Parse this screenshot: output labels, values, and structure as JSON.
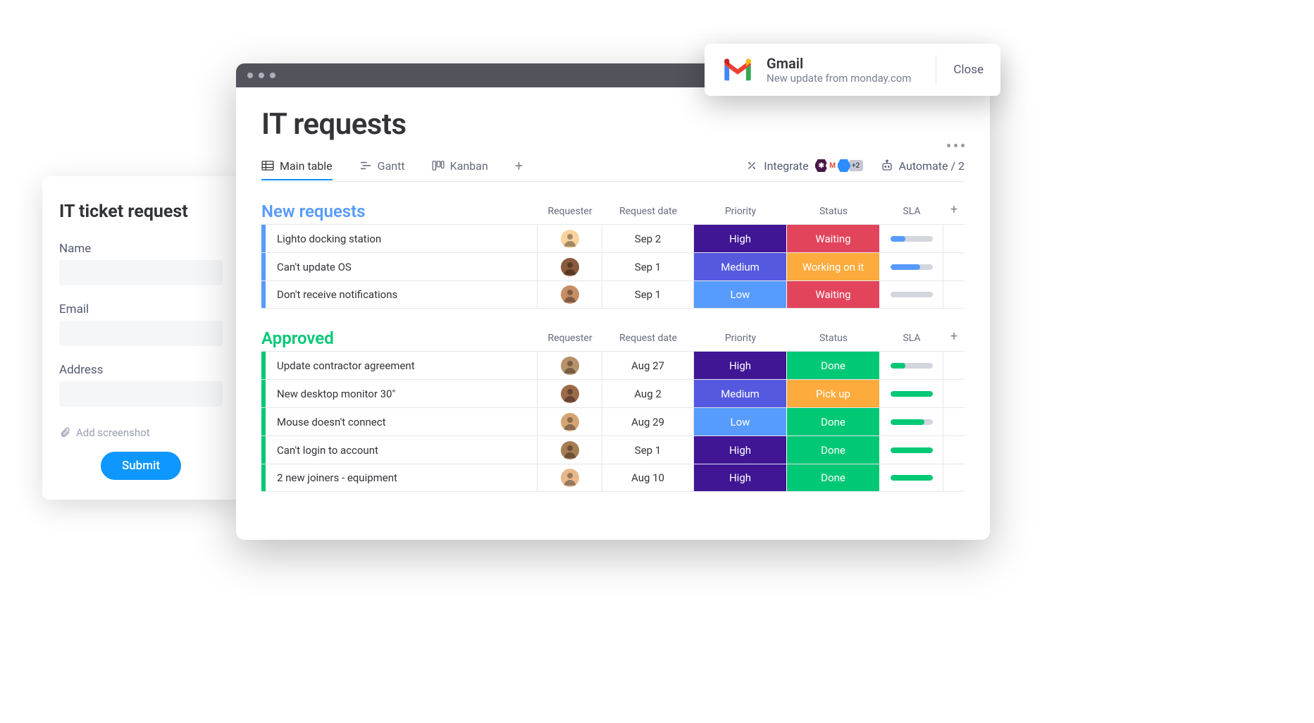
{
  "form": {
    "title": "IT ticket request",
    "fields": {
      "name": "Name",
      "email": "Email",
      "address": "Address"
    },
    "add_screenshot": "Add screenshot",
    "submit": "Submit"
  },
  "board": {
    "title": "IT requests",
    "tabs": [
      {
        "label": "Main table"
      },
      {
        "label": "Gantt"
      },
      {
        "label": "Kanban"
      }
    ],
    "integrate_label": "Integrate",
    "integrate_more": "+2",
    "automate_label": "Automate / 2",
    "columns": {
      "requester": "Requester",
      "date": "Request date",
      "priority": "Priority",
      "status": "Status",
      "sla": "SLA"
    },
    "groups": [
      {
        "title": "New requests",
        "color": "blue",
        "rows": [
          {
            "name": "Lighto docking station",
            "avatar_bg": "#f9d29d",
            "date": "Sep 2",
            "priority": "High",
            "priority_color": "#401694",
            "status": "Waiting",
            "status_color": "#e2445c",
            "sla_pct": 35,
            "sla_color": "#579bfc"
          },
          {
            "name": "Can't update OS",
            "avatar_bg": "#8b5a3c",
            "date": "Sep 1",
            "priority": "Medium",
            "priority_color": "#5559df",
            "status": "Working on it",
            "status_color": "#fdab3d",
            "sla_pct": 70,
            "sla_color": "#579bfc"
          },
          {
            "name": "Don't receive notifications",
            "avatar_bg": "#c78d64",
            "date": "Sep 1",
            "priority": "Low",
            "priority_color": "#579bfc",
            "status": "Waiting",
            "status_color": "#e2445c",
            "sla_pct": 0,
            "sla_color": "#d4d6de"
          }
        ]
      },
      {
        "title": "Approved",
        "color": "green",
        "rows": [
          {
            "name": "Update contractor agreement",
            "avatar_bg": "#b8906a",
            "date": "Aug 27",
            "priority": "High",
            "priority_color": "#401694",
            "status": "Done",
            "status_color": "#00c875",
            "sla_pct": 35,
            "sla_color": "#00c875"
          },
          {
            "name": "New desktop monitor 30\"",
            "avatar_bg": "#9b6b4a",
            "date": "Aug 2",
            "priority": "Medium",
            "priority_color": "#5559df",
            "status": "Pick up",
            "status_color": "#fdab3d",
            "sla_pct": 100,
            "sla_color": "#00c875"
          },
          {
            "name": "Mouse doesn't connect",
            "avatar_bg": "#d4a574",
            "date": "Aug 29",
            "priority": "Low",
            "priority_color": "#579bfc",
            "status": "Done",
            "status_color": "#00c875",
            "sla_pct": 80,
            "sla_color": "#00c875"
          },
          {
            "name": "Can't login to account",
            "avatar_bg": "#a67c52",
            "date": "Sep 1",
            "priority": "High",
            "priority_color": "#401694",
            "status": "Done",
            "status_color": "#00c875",
            "sla_pct": 100,
            "sla_color": "#00c875"
          },
          {
            "name": "2 new joiners - equipment",
            "avatar_bg": "#e8b88a",
            "date": "Aug 10",
            "priority": "High",
            "priority_color": "#401694",
            "status": "Done",
            "status_color": "#00c875",
            "sla_pct": 100,
            "sla_color": "#00c875"
          }
        ]
      }
    ]
  },
  "toast": {
    "title": "Gmail",
    "subtitle": "New update from monday.com",
    "close": "Close"
  }
}
